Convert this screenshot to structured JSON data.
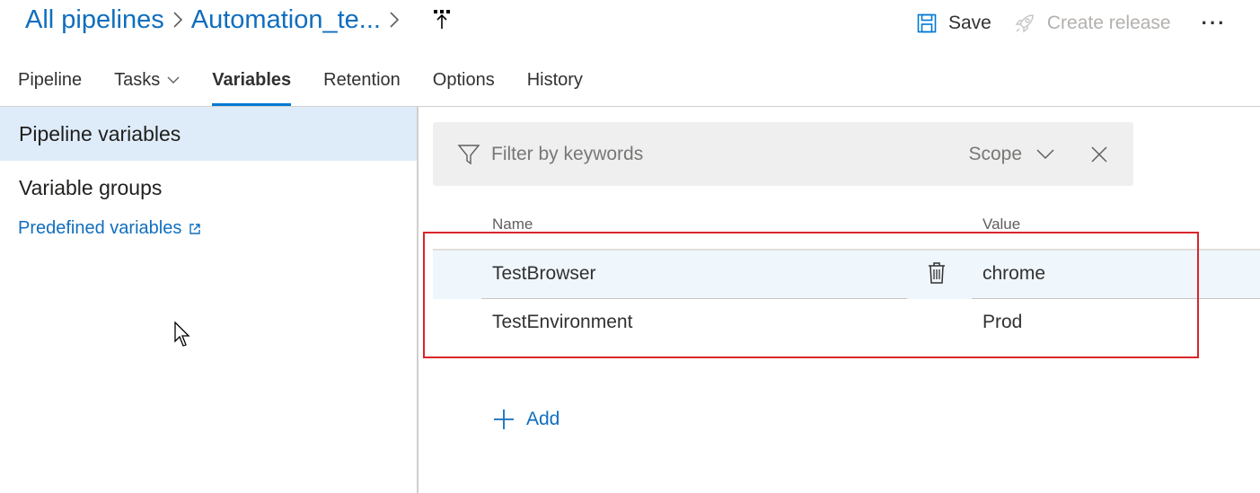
{
  "breadcrumb": {
    "root": "All pipelines",
    "pipeline": "Automation_te...",
    "icon": "pipeline-release-icon"
  },
  "actions": {
    "save": "Save",
    "create_release": "Create release",
    "more": "···"
  },
  "tabs": [
    {
      "label": "Pipeline"
    },
    {
      "label": "Tasks"
    },
    {
      "label": "Variables"
    },
    {
      "label": "Retention"
    },
    {
      "label": "Options"
    },
    {
      "label": "History"
    }
  ],
  "active_tab": "Variables",
  "left_pane": {
    "pipeline_variables": "Pipeline variables",
    "variable_groups": "Variable groups",
    "predefined_variables": "Predefined variables"
  },
  "filter": {
    "placeholder": "Filter by keywords",
    "scope": "Scope"
  },
  "grid": {
    "headers": {
      "name": "Name",
      "value": "Value"
    },
    "rows": [
      {
        "name": "TestBrowser",
        "value": "chrome"
      },
      {
        "name": "TestEnvironment",
        "value": "Prod"
      }
    ]
  },
  "add_label": "Add",
  "colors": {
    "accent": "#0078d4",
    "link": "#106ebe",
    "selected_bg": "#deecf9",
    "highlight_box": "#d9252a"
  }
}
